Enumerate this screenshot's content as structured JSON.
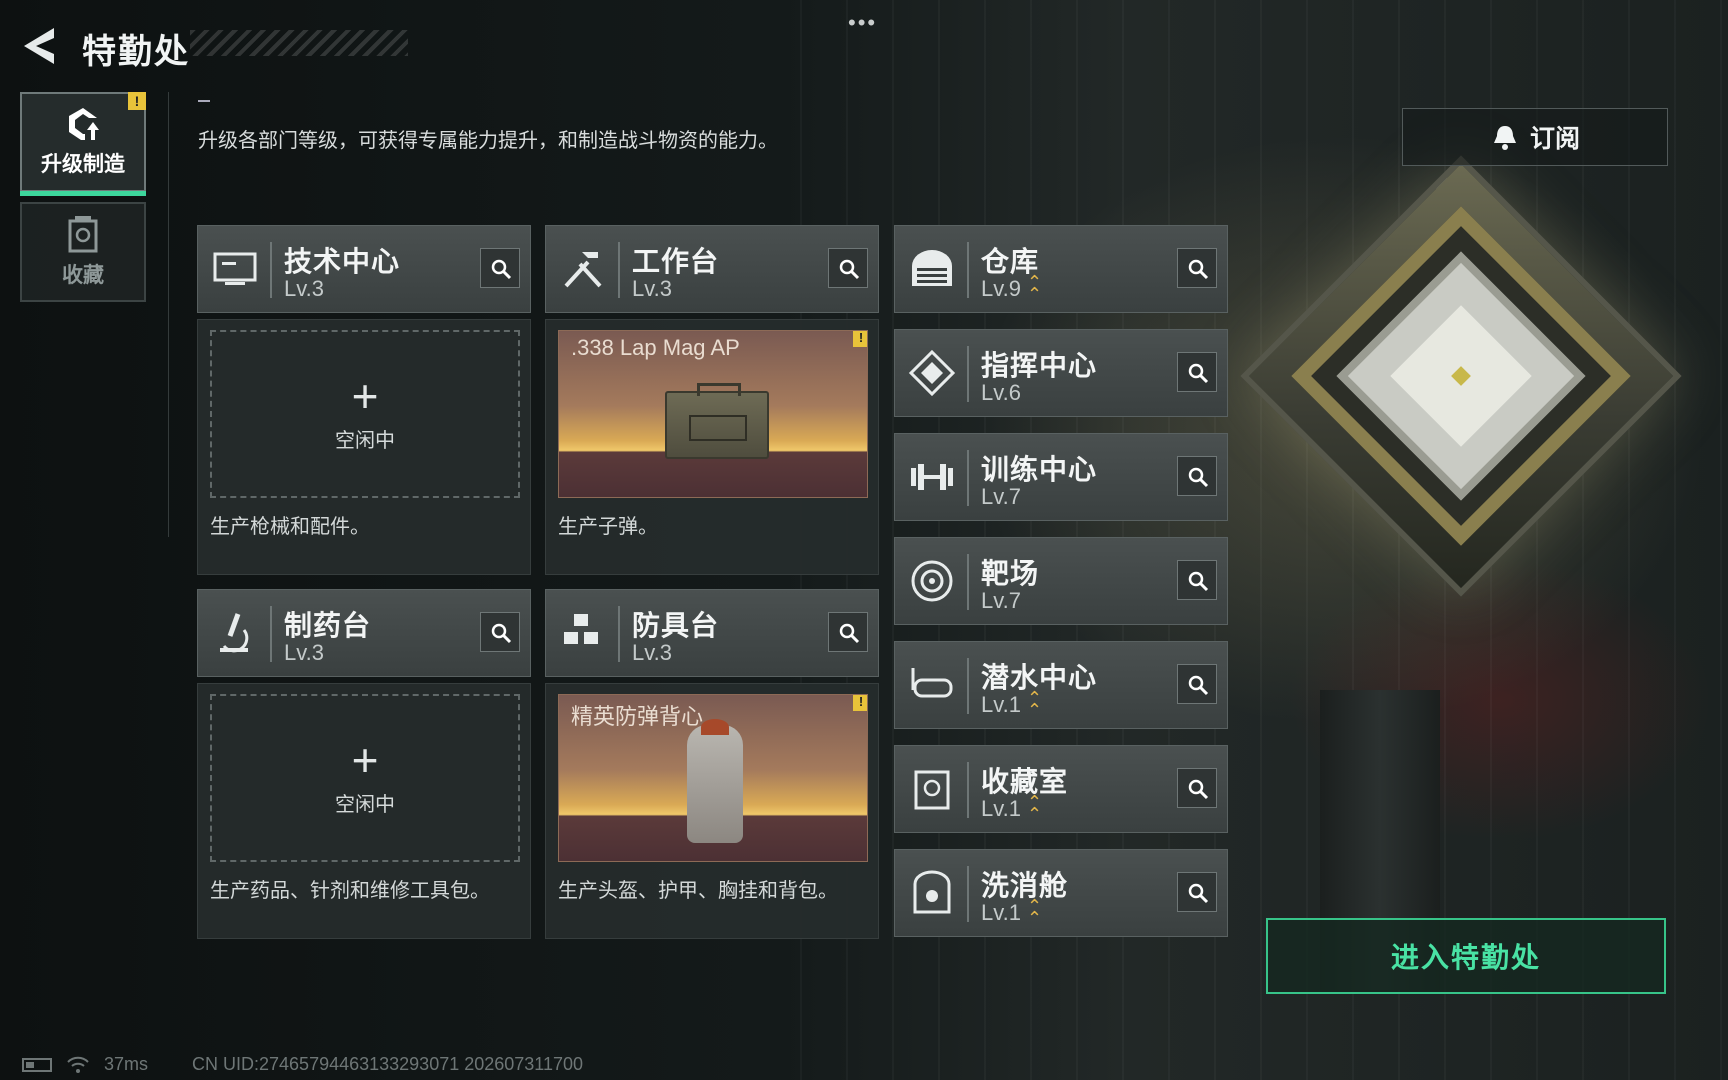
{
  "header": {
    "title": "特勤处",
    "menu_glyph": "•••"
  },
  "sidebar": {
    "tabs": [
      {
        "label": "升级制造",
        "icon": "upgrade-icon",
        "active": true,
        "badge": "!"
      },
      {
        "label": "收藏",
        "icon": "collection-icon",
        "active": false
      }
    ]
  },
  "description": "升级各部门等级，可获得专属能力提升，和制造战斗物资的能力。",
  "subscribe": {
    "label": "订阅",
    "icon": "bell-icon"
  },
  "departments": [
    {
      "name": "技术中心",
      "level": "Lv.3",
      "icon": "computer-icon"
    },
    {
      "name": "工作台",
      "level": "Lv.3",
      "icon": "tools-icon"
    },
    {
      "name": "制药台",
      "level": "Lv.3",
      "icon": "microscope-icon"
    },
    {
      "name": "防具台",
      "level": "Lv.3",
      "icon": "armor-parts-icon"
    },
    {
      "name": "仓库",
      "level": "Lv.9",
      "icon": "warehouse-icon",
      "upgradable": true
    },
    {
      "name": "指挥中心",
      "level": "Lv.6",
      "icon": "command-icon"
    },
    {
      "name": "训练中心",
      "level": "Lv.7",
      "icon": "dumbbell-icon"
    },
    {
      "name": "靶场",
      "level": "Lv.7",
      "icon": "target-icon"
    },
    {
      "name": "潜水中心",
      "level": "Lv.1",
      "icon": "diving-mask-icon",
      "upgradable": true
    },
    {
      "name": "收藏室",
      "level": "Lv.1",
      "icon": "collection-room-icon",
      "upgradable": true
    },
    {
      "name": "洗消舱",
      "level": "Lv.1",
      "icon": "decontamination-icon",
      "upgradable": true
    }
  ],
  "slots": {
    "tech": {
      "state": "空闲中",
      "desc": "生产枪械和配件。"
    },
    "workbench": {
      "item": ".338 Lap Mag AP",
      "desc": "生产子弹。",
      "badge": "!"
    },
    "pharmacy": {
      "state": "空闲中",
      "desc": "生产药品、针剂和维修工具包。"
    },
    "armor": {
      "item": "精英防弹背心",
      "desc": "生产头盔、护甲、胸挂和背包。",
      "badge": "!"
    }
  },
  "enter_button": {
    "label": "进入特勤处"
  },
  "status_bar": {
    "ping": "37ms",
    "uid": "CN UID:2746579446313329307​1 202607311700"
  },
  "colors": {
    "accent_green": "#3dd69c",
    "warn_yellow": "#e8c33a",
    "level_up": "#e3b64a"
  }
}
